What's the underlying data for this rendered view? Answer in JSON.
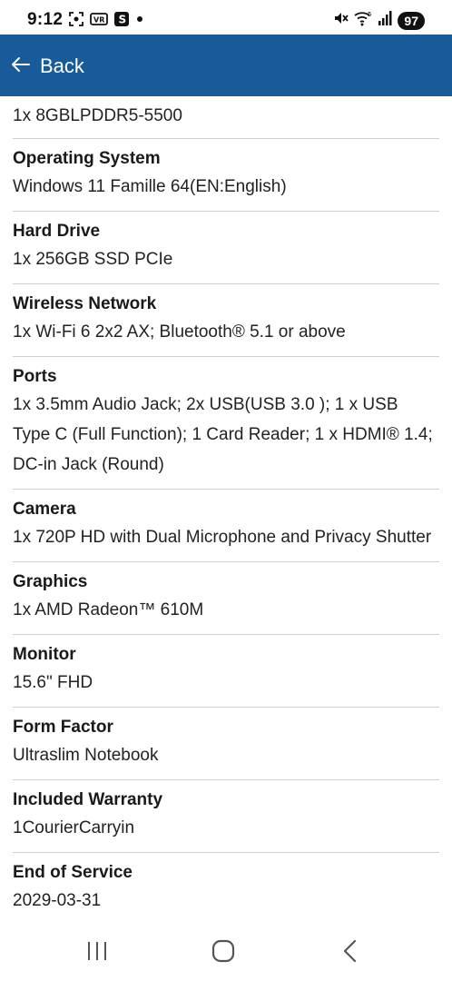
{
  "status_bar": {
    "time": "9:12",
    "battery": "97",
    "icons": [
      "screenshot-icon",
      "vr-icon",
      "s-app-icon",
      "dot-icon",
      "mute-icon",
      "wifi-icon",
      "signal-icon"
    ]
  },
  "header": {
    "back_label": "Back",
    "background_color": "#175b98"
  },
  "top_value": "1x 8GBLPDDR5-5500",
  "specs": [
    {
      "label": "Operating System",
      "value": "Windows 11 Famille 64(EN:English)"
    },
    {
      "label": "Hard Drive",
      "value": "1x 256GB SSD PCIe"
    },
    {
      "label": "Wireless Network",
      "value": "1x Wi-Fi 6 2x2 AX; Bluetooth® 5.1 or above"
    },
    {
      "label": "Ports",
      "value": "1x 3.5mm Audio Jack; 2x USB(USB 3.0 ); 1 x USB Type C (Full Function); 1 Card Reader; 1 x HDMI® 1.4; DC-in Jack (Round)"
    },
    {
      "label": "Camera",
      "value": "1x 720P HD with Dual Microphone and Privacy Shutter"
    },
    {
      "label": "Graphics",
      "value": "1x AMD Radeon™ 610M"
    },
    {
      "label": "Monitor",
      "value": "15.6\" FHD"
    },
    {
      "label": "Form Factor",
      "value": "Ultraslim Notebook"
    },
    {
      "label": "Included Warranty",
      "value": "1CourierCarryin"
    },
    {
      "label": "End of Service",
      "value": "2029-03-31"
    }
  ],
  "nav": {
    "icons": [
      "recent-apps-icon",
      "home-icon",
      "back-nav-icon"
    ]
  }
}
